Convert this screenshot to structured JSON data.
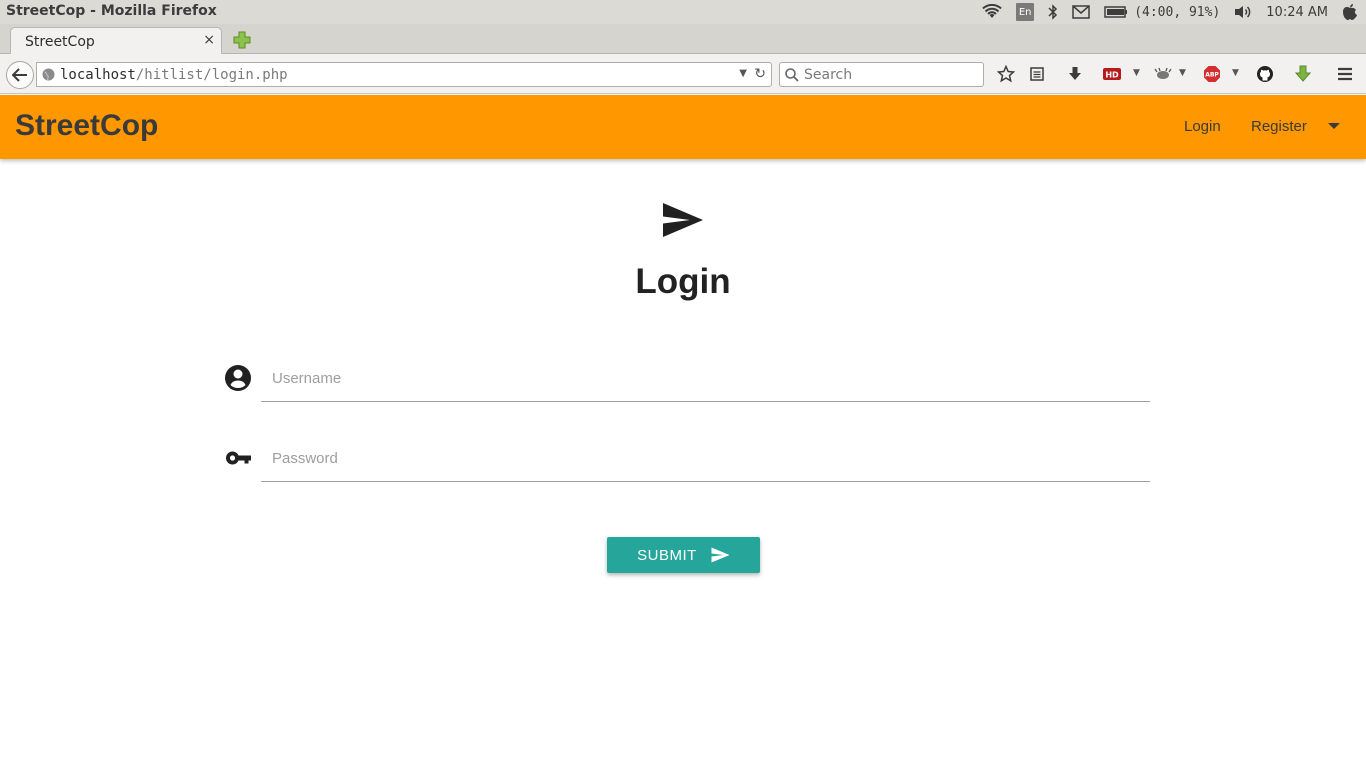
{
  "os": {
    "window_title": "StreetCop - Mozilla Firefox",
    "lang_indicator": "En",
    "battery_text": "(4:00, 91%)",
    "clock": "10:24 AM"
  },
  "browser": {
    "tab_title": "StreetCop",
    "tab_close": "×",
    "url_host": "localhost",
    "url_path": "/hitlist/login.php",
    "search_placeholder": "Search"
  },
  "app": {
    "brand": "StreetCop",
    "nav": {
      "login": "Login",
      "register": "Register"
    },
    "header_color": "#ff9800"
  },
  "login": {
    "title": "Login",
    "username_placeholder": "Username",
    "password_placeholder": "Password",
    "submit_label": "SUBMIT",
    "submit_color": "#26a69a"
  }
}
